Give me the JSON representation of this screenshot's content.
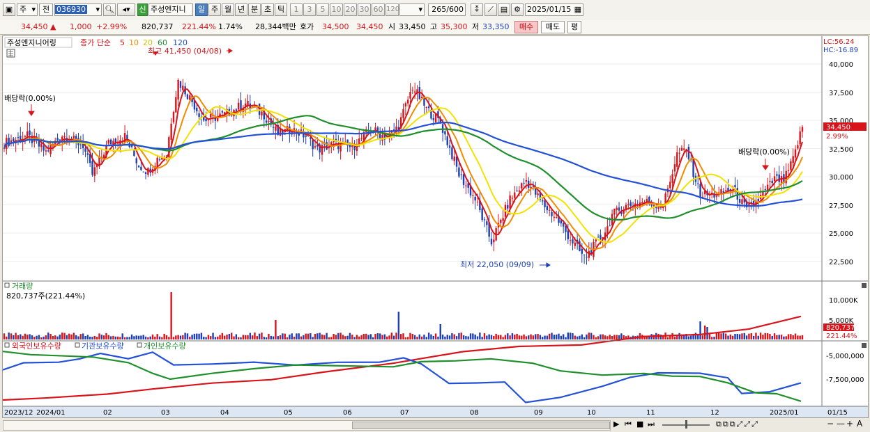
{
  "toolbar": {
    "market_label": "주",
    "prev_label": "전",
    "stock_code": "036930",
    "new_badge": "신",
    "stock_name": "주성엔지니",
    "periods": [
      "일",
      "주",
      "월",
      "년",
      "분",
      "초",
      "틱"
    ],
    "active_period": "일",
    "intervals": [
      "1",
      "3",
      "5",
      "10",
      "20",
      "30",
      "60",
      "120"
    ],
    "count_value": "265",
    "count_total": "/600",
    "date_value": "2025/01/15"
  },
  "quote": {
    "price": "34,450",
    "change": "1,000",
    "change_pct": "+2.99%",
    "volume": "820,737",
    "volume_pct": "221.44%",
    "turnover": "1.74%",
    "amount": "28,344백만",
    "ask_label": "호가",
    "ask1": "34,500",
    "ask2": "34,450",
    "open_label": "시",
    "open": "33,450",
    "high_label": "고",
    "high": "35,300",
    "low_label": "저",
    "low": "33,350",
    "buy_label": "매수",
    "sell_label": "매도",
    "avg_label": "평"
  },
  "price_panel": {
    "title": "주성엔지니어링",
    "ma_label": "종가 단순",
    "ma_periods": [
      "5",
      "10",
      "20",
      "60",
      "120"
    ],
    "ma_colors": [
      "#d8141b",
      "#f08c00",
      "#f2e200",
      "#1f8f2c",
      "#2250d6"
    ],
    "lc_label": "LC:56.24",
    "hc_label": "HC:-16.89",
    "y_ticks": [
      "40,000",
      "37,500",
      "35,000",
      "32,500",
      "30,000",
      "27,500",
      "25,000",
      "22,500"
    ],
    "current_price_tag": "34,450",
    "current_pct_tag": "2.99%",
    "high_annotation": "최고 41,450 (04/08)",
    "low_annotation": "최저 22,050 (09/09)",
    "dividend_left": "배당락(0.00%)",
    "dividend_right": "배당락(0.00%)"
  },
  "volume_panel": {
    "title": "거래량",
    "value_label": "820,737주(221.44%)",
    "y_ticks": [
      "10,000K",
      "5,000K"
    ],
    "current_tag": "820,737",
    "current_pct_tag": "221.44%"
  },
  "holding_panel": {
    "series": [
      "외국인보유수량",
      "기관보유수량",
      "개인보유수량"
    ],
    "series_colors": [
      "#d8141b",
      "#2250d6",
      "#1f8f2c"
    ],
    "y_ticks": [
      "-5,000,000",
      "-7,500,000"
    ]
  },
  "x_axis": {
    "labels": [
      "2023/12",
      "2024/01",
      "02",
      "03",
      "04",
      "05",
      "06",
      "07",
      "08",
      "09",
      "10",
      "11",
      "12",
      "2025/01"
    ],
    "end_label": "01/15"
  },
  "colors": {
    "up": "#d8141b",
    "down": "#1d3fb3",
    "active_tab": "#4a7fbf"
  }
}
